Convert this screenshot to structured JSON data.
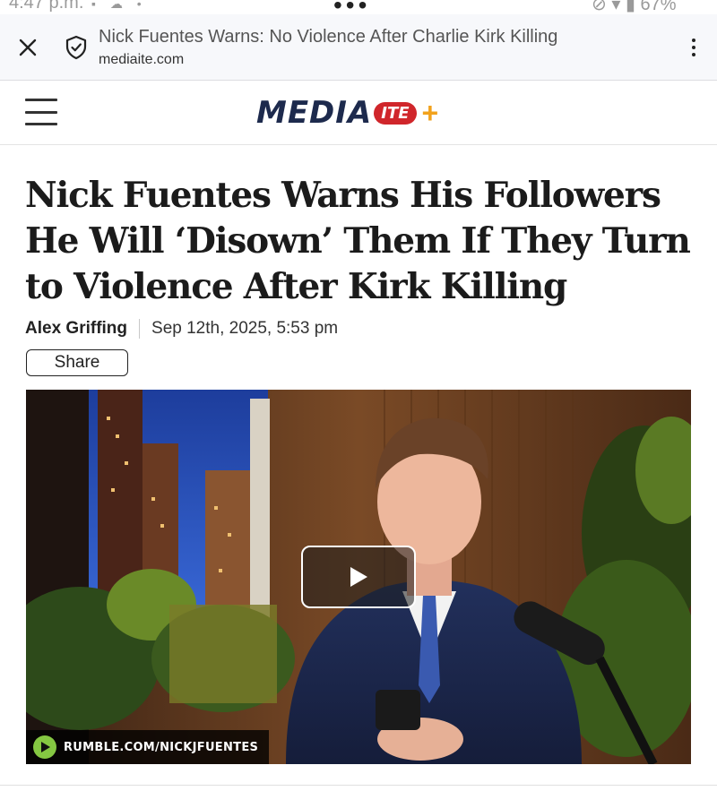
{
  "status_bar": {
    "time": "4:47 p.m.",
    "battery": "67%"
  },
  "browser": {
    "tab_title": "Nick Fuentes Warns: No Violence After Charlie Kirk Killing",
    "domain": "mediaite.com",
    "icons": [
      "close-icon",
      "shield-icon",
      "more-vert-icon"
    ]
  },
  "site": {
    "logo_main": "MEDIA",
    "logo_badge": "ITE",
    "logo_plus": "+",
    "colors": {
      "navy": "#1d2a4d",
      "red": "#d0262b",
      "orange": "#f2a21c"
    }
  },
  "article": {
    "headline": "Nick Fuentes Warns His Followers He Will ‘Disown’ Them If They Turn to Violence After Kirk Killing",
    "author": "Alex Griffing",
    "date": "Sep 12th, 2025, 5:53 pm",
    "share_label": "Share"
  },
  "video": {
    "source_label": "RUMBLE.COM/NICKJFUENTES",
    "brand_color": "#85c742"
  }
}
